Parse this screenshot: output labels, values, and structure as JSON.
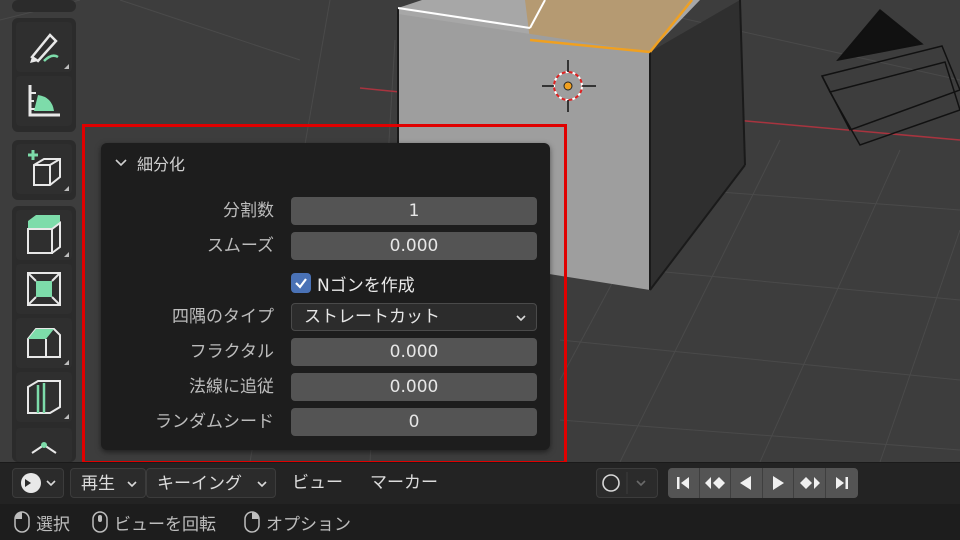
{
  "operator_panel": {
    "title": "細分化",
    "properties": [
      {
        "label": "分割数",
        "value": "1"
      },
      {
        "label": "スムーズ",
        "value": "0.000"
      }
    ],
    "checkbox": {
      "label": "Nゴンを作成",
      "checked": true
    },
    "corner_type": {
      "label": "四隅のタイプ",
      "value": "ストレートカット"
    },
    "properties2": [
      {
        "label": "フラクタル",
        "value": "0.000"
      },
      {
        "label": "法線に追従",
        "value": "0.000"
      },
      {
        "label": "ランダムシード",
        "value": "0"
      }
    ]
  },
  "timeline": {
    "playback_label": "再生",
    "keying_label": "キーイング",
    "view_label": "ビュー",
    "marker_label": "マーカー"
  },
  "status_bar": {
    "hint_select": "選択",
    "hint_rotate_view": "ビューを回転",
    "hint_options": "オプション"
  },
  "toolbar_icons": [
    "annotate-icon",
    "measure-icon",
    "add-cube-icon",
    "extrude-region-icon",
    "inset-faces-icon",
    "bevel-icon",
    "loop-cut-icon",
    "knife-icon"
  ],
  "colors": {
    "accent_checkbox": "#4a72b6",
    "highlight": "#e00000",
    "selection_edge": "#f0a020",
    "tool_green": "#7ddcaa"
  }
}
